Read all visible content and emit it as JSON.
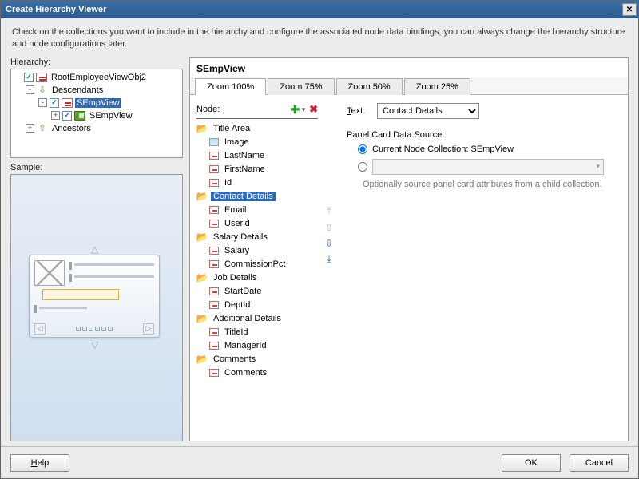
{
  "title": "Create Hierarchy Viewer",
  "description": "Check on the collections you want to include in the hierarchy and configure the associated node data bindings, you can always change the hierarchy structure and node configurations later.",
  "hierarchy": {
    "label": "Hierarchy:",
    "nodes": [
      {
        "indent": 0,
        "expander": "",
        "checked": true,
        "icon": "hier",
        "label": "RootEmployeeViewObj2"
      },
      {
        "indent": 1,
        "expander": "-",
        "checked": null,
        "icon": "desc",
        "label": "Descendants"
      },
      {
        "indent": 2,
        "expander": "-",
        "checked": true,
        "icon": "hier",
        "label": "SEmpView",
        "selected": true
      },
      {
        "indent": 3,
        "expander": "+",
        "checked": true,
        "icon": "view",
        "label": "SEmpView"
      },
      {
        "indent": 1,
        "expander": "+",
        "checked": null,
        "icon": "anc",
        "label": "Ancestors"
      }
    ]
  },
  "sample": {
    "label": "Sample:"
  },
  "right": {
    "section_title": "SEmpView",
    "zoom_tabs": [
      "Zoom 100%",
      "Zoom 75%",
      "Zoom 50%",
      "Zoom 25%"
    ],
    "zoom_active": 0,
    "node_label": "Node:",
    "node_tree": [
      {
        "indent": 0,
        "icon": "folder",
        "label": "Title Area"
      },
      {
        "indent": 1,
        "icon": "img",
        "label": "Image"
      },
      {
        "indent": 1,
        "icon": "field",
        "label": "LastName"
      },
      {
        "indent": 1,
        "icon": "field",
        "label": "FirstName"
      },
      {
        "indent": 1,
        "icon": "field",
        "label": "Id"
      },
      {
        "indent": 0,
        "icon": "folder",
        "label": "Contact Details",
        "selected": true
      },
      {
        "indent": 1,
        "icon": "field",
        "label": "Email"
      },
      {
        "indent": 1,
        "icon": "field",
        "label": "Userid"
      },
      {
        "indent": 0,
        "icon": "folder",
        "label": "Salary Details"
      },
      {
        "indent": 1,
        "icon": "field",
        "label": "Salary"
      },
      {
        "indent": 1,
        "icon": "field",
        "label": "CommissionPct"
      },
      {
        "indent": 0,
        "icon": "folder",
        "label": "Job Details"
      },
      {
        "indent": 1,
        "icon": "field",
        "label": "StartDate"
      },
      {
        "indent": 1,
        "icon": "field",
        "label": "DeptId"
      },
      {
        "indent": 0,
        "icon": "folder",
        "label": "Additional Details"
      },
      {
        "indent": 1,
        "icon": "field",
        "label": "TitleId"
      },
      {
        "indent": 1,
        "icon": "field",
        "label": "ManagerId"
      },
      {
        "indent": 0,
        "icon": "folder",
        "label": "Comments"
      },
      {
        "indent": 1,
        "icon": "field",
        "label": "Comments"
      }
    ],
    "text_label": "Text:",
    "text_value": "Contact Details",
    "pcd_label": "Panel Card Data Source:",
    "pcd_option1": "Current Node Collection: SEmpView",
    "pcd_hint": "Optionally source panel card attributes from a child collection."
  },
  "footer": {
    "help": "Help",
    "ok": "OK",
    "cancel": "Cancel"
  }
}
